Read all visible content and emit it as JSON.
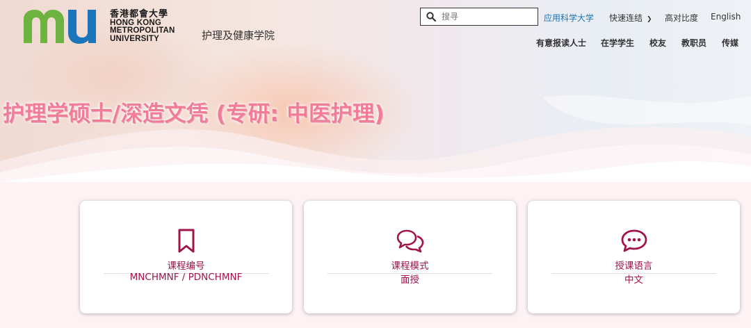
{
  "header": {
    "logo": {
      "mark": "mu",
      "name_zh": "香港都會大學",
      "name_en_lines": [
        "HONG KONG",
        "METROPOLITAN",
        "UNIVERSITY"
      ]
    },
    "school_name": "护理及健康学院",
    "search": {
      "placeholder": "搜寻"
    },
    "top_links": {
      "applied_sciences": "应用科学大学",
      "quick_links": "快速连结",
      "high_contrast": "高对比度",
      "english": "English"
    },
    "sub_links": [
      "有意报读人士",
      "在学学生",
      "校友",
      "教职员",
      "传媒"
    ]
  },
  "hero": {
    "title": "护理学硕士/深造文凭 (专研: 中医护理)"
  },
  "cards": [
    {
      "icon": "bookmark-icon",
      "label": "课程编号",
      "value": "MNCHMNF / PDNCHMNF"
    },
    {
      "icon": "chat-bubbles-icon",
      "label": "课程模式",
      "value": "面授"
    },
    {
      "icon": "speech-bubble-icon",
      "label": "授课语言",
      "value": "中文"
    }
  ],
  "colors": {
    "brand_green": "#6cb33f",
    "brand_blue": "#1b75bb",
    "accent_magenta": "#a0144b",
    "link_blue": "#1a73b8",
    "title_pink": "#f07c98"
  }
}
